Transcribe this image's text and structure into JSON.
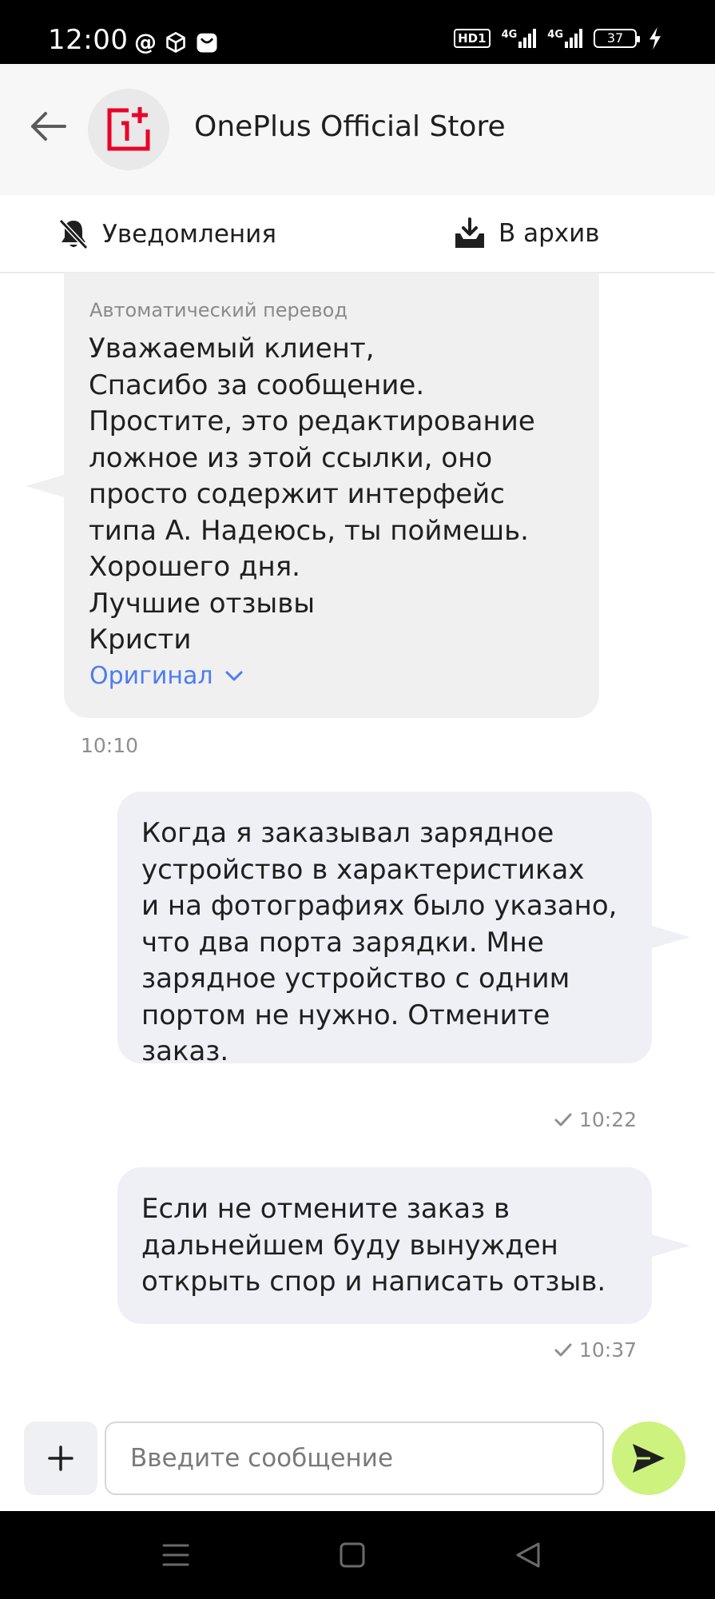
{
  "status_bar": {
    "time": "12:00",
    "hd_label": "HD1",
    "network_1": "4G",
    "network_2": "4G",
    "battery": "37"
  },
  "header": {
    "store_name": "OnePlus Official Store",
    "brand_color": "#eb0028"
  },
  "actions": {
    "notifications": "Уведомления",
    "archive": "В архив"
  },
  "messages": [
    {
      "direction": "incoming",
      "translation_label": "Автоматический перевод",
      "text": "Уважаемый клиент,\nСпасибо за сообщение.\nПростите, это редактирование\nложное из этой ссылки, оно\nпросто содержит интерфейс\nтипа A. Надеюсь, ты поймешь.\nХорошего дня.\nЛучшие отзывы\nКристи",
      "original_link": "Оригинал",
      "time": "10:10"
    },
    {
      "direction": "outgoing",
      "text": "Когда я заказывал зарядное\nустройство в характеристиках\nи на фотографиях было указано,\nчто два порта зарядки. Мне\nзарядное устройство с одним\nпортом не нужно. Отмените\nзаказ.",
      "time": "10:22"
    },
    {
      "direction": "outgoing",
      "text": "Если не отмените заказ в\nдальнейшем буду вынужден\nоткрыть спор и написать отзыв.",
      "time": "10:37"
    }
  ],
  "composer": {
    "placeholder": "Введите сообщение",
    "value": ""
  },
  "colors": {
    "send_button": "#cdf27e",
    "link": "#4c7cf0",
    "incoming_bubble": "#f0f0f0",
    "outgoing_bubble": "#eef0f6"
  }
}
